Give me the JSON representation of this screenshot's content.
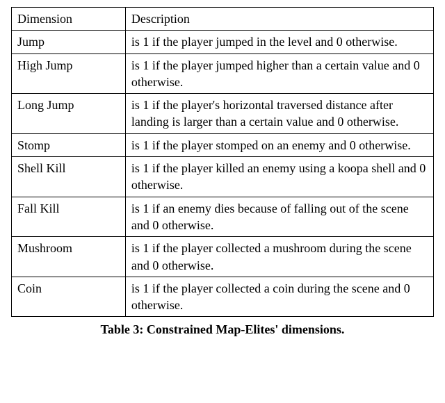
{
  "table": {
    "headers": {
      "dimension": "Dimension",
      "description": "Description"
    },
    "rows": [
      {
        "dimension": "Jump",
        "description": "is 1 if the player jumped in the level and 0 otherwise."
      },
      {
        "dimension": "High Jump",
        "description": "is 1 if the player jumped higher than a certain value and 0 otherwise."
      },
      {
        "dimension": "Long Jump",
        "description": "is 1 if the player's horizontal traversed distance after landing is larger than a certain value and 0 otherwise."
      },
      {
        "dimension": "Stomp",
        "description": "is 1 if the player stomped on an enemy and 0 otherwise."
      },
      {
        "dimension": "Shell Kill",
        "description": "is 1 if the player killed an enemy using a koopa shell and 0 otherwise."
      },
      {
        "dimension": "Fall Kill",
        "description": "is 1 if an enemy dies because of falling out of the scene and 0 otherwise."
      },
      {
        "dimension": "Mushroom",
        "description": "is 1 if the player collected a mushroom during the scene and 0 otherwise."
      },
      {
        "dimension": "Coin",
        "description": "is 1 if the player collected a coin during the scene and 0 otherwise."
      }
    ],
    "caption": "Table 3: Constrained Map-Elites' dimensions."
  }
}
